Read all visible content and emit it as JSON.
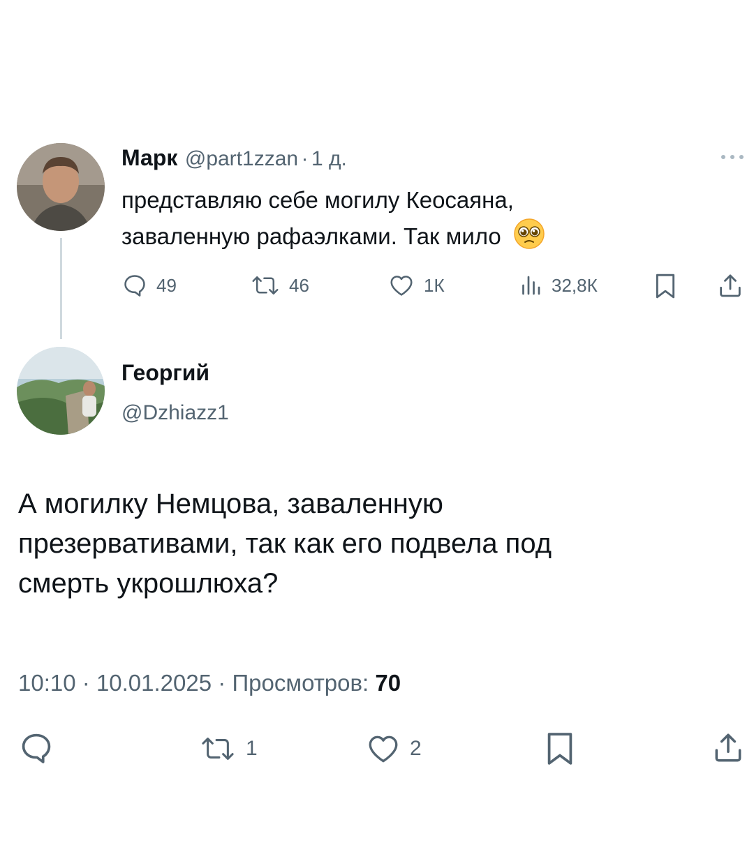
{
  "original_tweet": {
    "author_name": "Марк",
    "handle": "@part1zzan",
    "separator": "·",
    "time_ago": "1 д.",
    "text_line1": "представляю себе могилу Кеосаяна,",
    "text_line2": "заваленную рафаэлками. Так мило",
    "emoji": "🥹",
    "actions": {
      "replies": "49",
      "retweets": "46",
      "likes": "1К",
      "views": "32,8К"
    }
  },
  "reply_tweet": {
    "author_name": "Георгий",
    "handle": "@Dzhiazz1",
    "text_line1": "А могилку Немцова, заваленную",
    "text_line2": "презервативами, так как его подвела под",
    "text_line3": "смерть укрошлюха?",
    "time": "10:10",
    "separator": "·",
    "date": "10.01.2025",
    "views_label": "Просмотров:",
    "views_count": "70",
    "actions": {
      "replies": "",
      "retweets": "1",
      "likes": "2"
    }
  },
  "icons": {
    "more": "more-dots-icon",
    "reply": "reply-bubble-icon",
    "retweet": "retweet-icon",
    "like": "heart-icon",
    "views": "views-bars-icon",
    "bookmark": "bookmark-icon",
    "share": "share-icon"
  },
  "colors": {
    "text": "#0f1419",
    "secondary": "#536471",
    "thread_line": "#cfd9de",
    "background": "#ffffff"
  }
}
